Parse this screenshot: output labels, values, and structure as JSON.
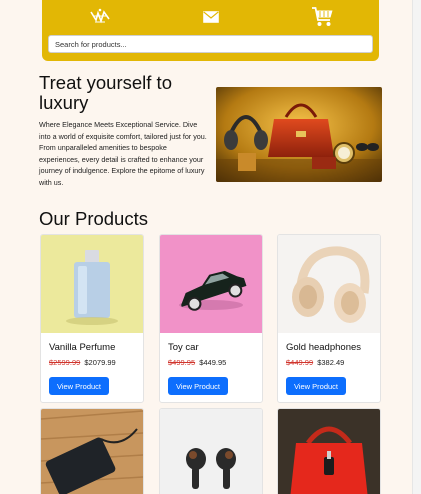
{
  "header": {
    "search_placeholder": "Search for products...",
    "icons": [
      "logo-icon",
      "mail-icon",
      "cart-icon"
    ],
    "background": "#e2b705"
  },
  "hero": {
    "title": "Treat yourself to luxury",
    "text": "Where Elegance Meets Exceptional Service. Dive into a world of exquisite comfort, tailored just for you. From unparalleled amenities to bespoke experiences, every detail is crafted to enhance your journey of indulgence. Explore the epitome of luxury with us."
  },
  "products_section": {
    "title": "Our Products",
    "items": [
      {
        "name": "Vanilla Perfume",
        "old_price": "$2599.99",
        "price": "$2079.99",
        "button": "View Product"
      },
      {
        "name": "Toy car",
        "old_price": "$499.95",
        "price": "$449.95",
        "button": "View Product"
      },
      {
        "name": "Gold headphones",
        "old_price": "$449.99",
        "price": "$382.49",
        "button": "View Product"
      }
    ]
  },
  "colors": {
    "accent": "#0d6efd",
    "old_price": "#d0342c",
    "page_bg": "#fdf6ef"
  }
}
